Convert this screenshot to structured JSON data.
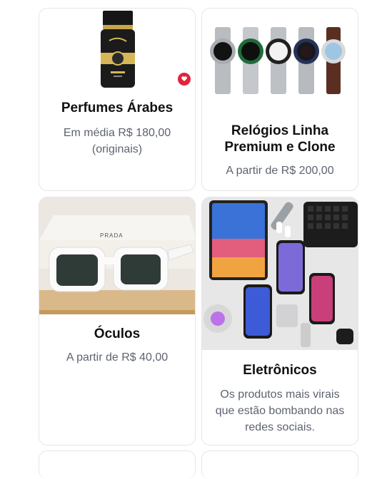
{
  "cards": [
    {
      "title": "Perfumes Árabes",
      "description": "Em média R$ 180,00 (originais)",
      "image": "arabic-perfume-bottle"
    },
    {
      "title": "Relógios Linha Premium e Clone",
      "description": "A partir de R$ 200,00",
      "image": "luxury-watches-row"
    },
    {
      "title": "Óculos",
      "description": "A partir de R$ 40,00",
      "image": "white-sunglasses-prada-box",
      "brand_text": "PRADA"
    },
    {
      "title": "Eletrônicos",
      "description": "Os produtos mais virais que estão bombando nas redes sociais.",
      "image": "apple-electronics-flatlay"
    }
  ],
  "colors": {
    "title": "#111111",
    "description": "#5d6370",
    "border": "#e6e6ea",
    "badge": "#e0243c"
  }
}
